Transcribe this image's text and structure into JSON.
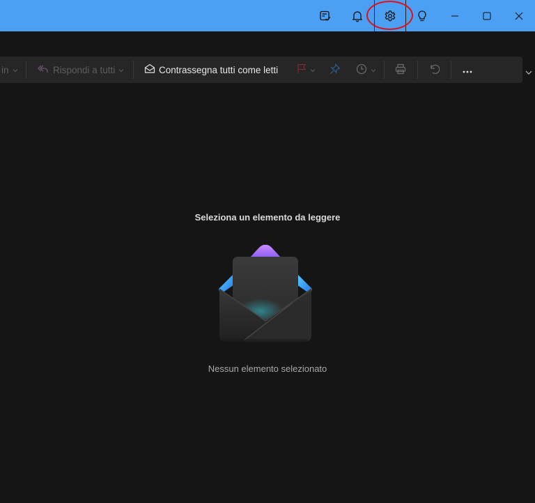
{
  "titlebar": {
    "accent": "#4ba0f3",
    "buttons": [
      {
        "name": "whats-new",
        "icon": "note-check-icon"
      },
      {
        "name": "notifications",
        "icon": "bell-icon"
      },
      {
        "name": "settings",
        "icon": "gear-icon",
        "highlighted": true
      },
      {
        "name": "tips",
        "icon": "lightbulb-icon"
      },
      {
        "name": "minimize",
        "icon": "minimize-icon"
      },
      {
        "name": "maximize",
        "icon": "maximize-icon"
      },
      {
        "name": "close",
        "icon": "close-icon"
      }
    ]
  },
  "toolbar": {
    "partial_label": "in",
    "reply_all_label": "Rispondi a tutti",
    "mark_all_read_label": "Contrassegna tutti come letti",
    "icons": [
      "reply-all-icon",
      "mail-read-icon",
      "flag-icon",
      "pin-icon",
      "clock-icon",
      "print-icon",
      "undo-icon",
      "more-icon"
    ]
  },
  "reading_pane": {
    "title": "Seleziona un elemento da leggere",
    "subtitle": "Nessun elemento selezionato",
    "illustration": "open-envelope-icon"
  },
  "annotation": {
    "color": "#e0101a",
    "target": "settings"
  }
}
